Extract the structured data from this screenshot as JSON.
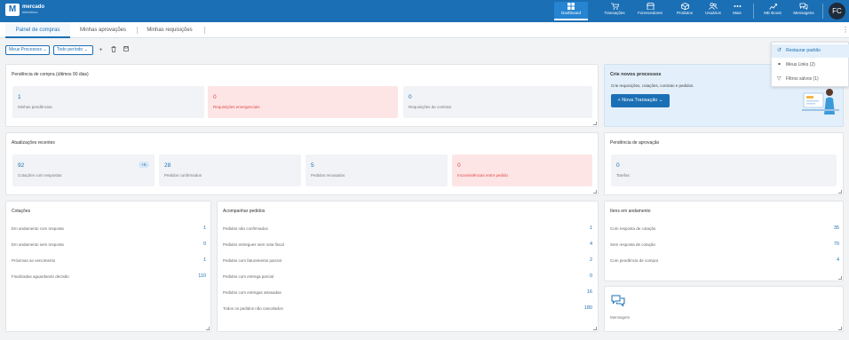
{
  "brand": {
    "line1": "mercado",
    "line2": "eletrônico"
  },
  "nav": [
    {
      "label": "Dashboard",
      "icon": "dashboard-icon",
      "active": true
    },
    {
      "label": "Transações",
      "icon": "cart-icon"
    },
    {
      "label": "Fornecedores",
      "icon": "store-icon"
    },
    {
      "label": "Produtos",
      "icon": "box-icon"
    },
    {
      "label": "Usuários",
      "icon": "users-icon"
    },
    {
      "label": "Mais",
      "icon": "more-icon"
    },
    {
      "label": "ME Boost",
      "icon": "chart-icon"
    },
    {
      "label": "Mensagens",
      "icon": "chat-icon"
    }
  ],
  "user_initials": "FC",
  "tabs": [
    "Painel de compras",
    "Minhas aprovações",
    "Minhas requisições"
  ],
  "toolbar": {
    "process_filter": "Meus Processos",
    "period_filter": "Todo período"
  },
  "pending": {
    "title": "Pendência de compra (últimos 90 dias)",
    "stats": [
      {
        "value": "1",
        "label": "Minhas pendências"
      },
      {
        "value": "0",
        "label": "Requisições emergenciais"
      },
      {
        "value": "0",
        "label": "Requisições de contrato"
      }
    ]
  },
  "create": {
    "title": "Crie novos processos",
    "subtitle": "Crie requisições, cotações, contrato e pedidos.",
    "button": "+ Nova Transação"
  },
  "updates": {
    "title": "Atualizações recentes",
    "stats": [
      {
        "value": "92",
        "label": "Cotações com respostas",
        "badge": "+5"
      },
      {
        "value": "28",
        "label": "Pedidos confirmados"
      },
      {
        "value": "5",
        "label": "Pedidos recusados"
      },
      {
        "value": "0",
        "label": "Inconsistências entre pedido"
      }
    ]
  },
  "approval": {
    "title": "Pendência de aprovação",
    "value": "0",
    "label": "Tarefas"
  },
  "cotacoes": {
    "title": "Cotações",
    "rows": [
      {
        "label": "Em andamento com resposta",
        "value": "1"
      },
      {
        "label": "Em andamento sem resposta",
        "value": "0"
      },
      {
        "label": "Próximas ao vencimento",
        "value": "1"
      },
      {
        "label": "Finalizadas aguardando decisão",
        "value": "110"
      }
    ]
  },
  "pedidos": {
    "title": "Acompanhar pedidos",
    "rows": [
      {
        "label": "Pedidos não confirmados",
        "value": "1"
      },
      {
        "label": "Pedidos entregues sem nota fiscal",
        "value": "4"
      },
      {
        "label": "Pedidos com faturamento parcial",
        "value": "2"
      },
      {
        "label": "Pedidos com entrega parcial",
        "value": "0"
      },
      {
        "label": "Pedidos com entregas atrasadas",
        "value": "16"
      },
      {
        "label": "Todos os pedidos não cancelados",
        "value": "180"
      }
    ]
  },
  "itens": {
    "title": "Itens em andamento",
    "rows": [
      {
        "label": "Com resposta de cotação",
        "value": "35"
      },
      {
        "label": "Sem resposta de cotação",
        "value": "70"
      },
      {
        "label": "Com pendência de compra",
        "value": "4"
      }
    ]
  },
  "messages": {
    "label": "Mensagem"
  },
  "dropdown": {
    "items": [
      {
        "label": "Restaurar padrão",
        "icon": "restore-icon"
      },
      {
        "label": "Meus Links (2)",
        "icon": "link-icon"
      },
      {
        "label": "Filtros salvos (1)",
        "icon": "filter-icon"
      }
    ]
  },
  "colors": {
    "primary": "#1b6fb5",
    "alert": "#e04848",
    "alert_bg": "#fde5e5"
  }
}
